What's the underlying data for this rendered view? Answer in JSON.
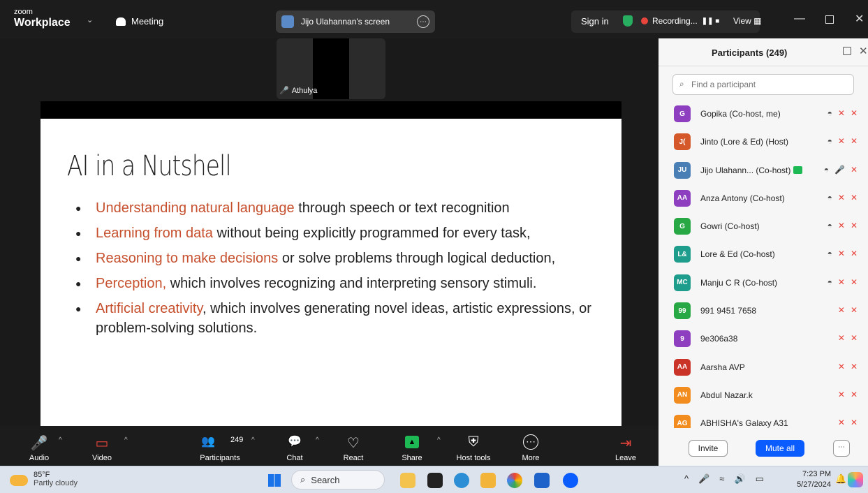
{
  "titlebar": {
    "brand_small": "zoom",
    "brand_big": "Workplace",
    "chevron": "⌄",
    "meeting_label": "Meeting",
    "screen_label": "Jijo Ulahannan's screen",
    "more_glyph": "⋯",
    "signin_label": "Sign in",
    "recording_label": "Recording...",
    "recording_controls": "❚❚ ■",
    "view_label": "View",
    "view_glyph": "▦",
    "minimize_glyph": "—",
    "close_glyph": "✕"
  },
  "stage": {
    "thumbnail_name": "Athulya",
    "mic_glyph": "🎤",
    "slide": {
      "title": "AI in a Nutshell",
      "bullets": [
        {
          "highlight": "Understanding natural language",
          "rest": " through speech or text recognition"
        },
        {
          "highlight": "Learning from data",
          "rest": " without being explicitly programmed for every task,"
        },
        {
          "highlight": "Reasoning to make decisions",
          "rest": " or solve problems through logical deduction,"
        },
        {
          "highlight": "Perception,",
          "rest": " which involves recognizing and interpreting sensory stimuli."
        },
        {
          "highlight": "Artificial creativity",
          "rest": ", which involves generating novel ideas, artistic expressions, or problem-solving solutions."
        }
      ]
    }
  },
  "toolbar": {
    "caret": "^",
    "audio_label": "Audio",
    "video_label": "Video",
    "participants_label": "Participants",
    "participants_count": "249",
    "chat_label": "Chat",
    "react_label": "React",
    "share_label": "Share",
    "host_tools_label": "Host tools",
    "more_label": "More",
    "leave_label": "Leave",
    "icons": {
      "audio": "🎤",
      "video": "▭",
      "participants": "👥",
      "chat": "💬",
      "react": "♡",
      "share": "▲",
      "host_tools": "⛨",
      "more": "⋯",
      "leave": "⇥"
    }
  },
  "panel": {
    "title": "Participants (249)",
    "close_glyph": "✕",
    "search_glyph": "⌕",
    "search_placeholder": "Find a participant",
    "participants": [
      {
        "initials": "G",
        "name": "Gopika (Co-host, me)",
        "color": "#8e3fbf",
        "cc": true,
        "mic": "✕",
        "cam": "✕"
      },
      {
        "initials": "J(",
        "name": "Jinto (Lore & Ed) (Host)",
        "color": "#d4582a",
        "cc": true,
        "mic": "✕",
        "cam": "✕"
      },
      {
        "initials": "JU",
        "name": "Jijo Ulahann...  (Co-host)",
        "color": "#4a7fb5",
        "cc": true,
        "mic": "🎤",
        "cam": "✕",
        "sharing": true
      },
      {
        "initials": "AA",
        "name": "Anza Antony (Co-host)",
        "color": "#8e3fbf",
        "cc": true,
        "mic": "✕",
        "cam": "✕"
      },
      {
        "initials": "G",
        "name": "Gowri (Co-host)",
        "color": "#27a844",
        "cc": true,
        "mic": "✕",
        "cam": "✕"
      },
      {
        "initials": "L&",
        "name": "Lore & Ed (Co-host)",
        "color": "#1e9c8c",
        "cc": true,
        "mic": "✕",
        "cam": "✕"
      },
      {
        "initials": "MC",
        "name": "Manju C R (Co-host)",
        "color": "#1e9c8c",
        "cc": true,
        "mic": "✕",
        "cam": "✕"
      },
      {
        "initials": "99",
        "name": "991 9451 7658",
        "color": "#27a844",
        "cc": false,
        "mic": "✕",
        "cam": "✕"
      },
      {
        "initials": "9",
        "name": "9e306a38",
        "color": "#8e3fbf",
        "cc": false,
        "mic": "✕",
        "cam": "✕"
      },
      {
        "initials": "AA",
        "name": "Aarsha AVP",
        "color": "#c93328",
        "cc": false,
        "mic": "✕",
        "cam": "✕"
      },
      {
        "initials": "AN",
        "name": "Abdul Nazar.k",
        "color": "#f28c1e",
        "cc": false,
        "mic": "✕",
        "cam": "✕"
      },
      {
        "initials": "AG",
        "name": "ABHISHA's Galaxy A31",
        "color": "#f28c1e",
        "cc": false,
        "mic": "✕",
        "cam": "✕"
      }
    ],
    "cc_glyph": "◓",
    "invite_label": "Invite",
    "mute_all_label": "Mute all",
    "more_glyph": "⋯"
  },
  "taskbar": {
    "temperature": "85°F",
    "condition": "Partly cloudy",
    "search_glyph": "⌕",
    "search_label": "Search",
    "tray_glyphs": [
      "^",
      "🎤",
      "≈",
      "🔊",
      "▭"
    ],
    "time": "7:23 PM",
    "date": "5/27/2024",
    "notification_glyph": "🔔"
  },
  "colors": {
    "accent_blue": "#0b5cff",
    "slide_highlight": "#c6502e",
    "muted_red": "#e8453c"
  }
}
